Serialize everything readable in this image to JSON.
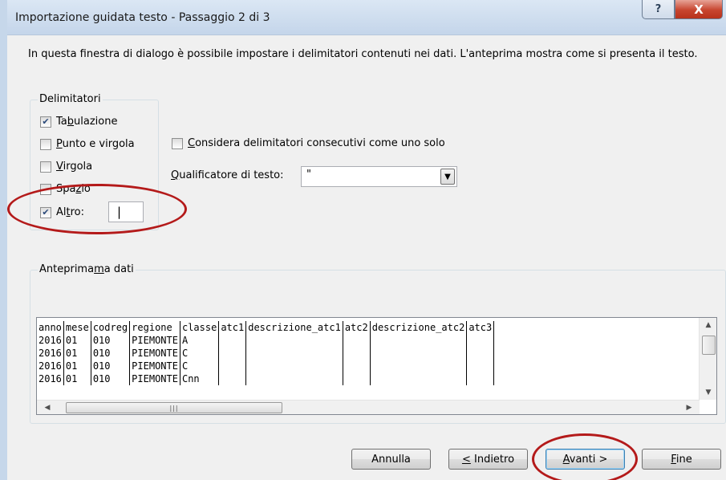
{
  "window": {
    "title": "Importazione guidata testo - Passaggio 2 di 3",
    "help_symbol": "?",
    "close_symbol": "X"
  },
  "intro_text": "In questa finestra di dialogo è possibile impostare i delimitatori contenuti nei dati. L'anteprima mostra come si presenta il testo.",
  "delimiters": {
    "legend": "Delimitatori",
    "tab": {
      "pre": "Ta",
      "key": "b",
      "post": "ulazione",
      "checked": true
    },
    "semicolon": {
      "pre": "",
      "key": "P",
      "post": "unto e virgola",
      "checked": false
    },
    "comma": {
      "pre": "",
      "key": "V",
      "post": "irgola",
      "checked": false
    },
    "space": {
      "pre": "Spa",
      "key": "z",
      "post": "io",
      "checked": false
    },
    "other": {
      "pre": "Al",
      "key": "t",
      "post": "ro:",
      "checked": true,
      "value": "|"
    }
  },
  "consecutive": {
    "pre": "",
    "key": "C",
    "post": "onsidera delimitatori consecutivi come uno solo",
    "checked": false
  },
  "qualifier": {
    "pre": "",
    "key": "Q",
    "post": "ualificatore di testo:",
    "value": "\""
  },
  "preview": {
    "legend_pre": "Anteprima",
    "legend_key": "m",
    "legend_post": "a dati",
    "rows": [
      [
        "anno",
        "mese",
        "codreg",
        "regione",
        "classe",
        "atc1",
        "descrizione_atc1",
        "atc2",
        "descrizione_atc2",
        "atc3"
      ],
      [
        "2016",
        "01",
        "010",
        "PIEMONTE",
        "A",
        "",
        "",
        "",
        "",
        ""
      ],
      [
        "2016",
        "01",
        "010",
        "PIEMONTE",
        "C",
        "",
        "",
        "",
        "",
        ""
      ],
      [
        "2016",
        "01",
        "010",
        "PIEMONTE",
        "C",
        "",
        "",
        "",
        "",
        ""
      ],
      [
        "2016",
        "01",
        "010",
        "PIEMONTE",
        "Cnn",
        "",
        "",
        "",
        "",
        ""
      ]
    ]
  },
  "buttons": {
    "cancel": "Annulla",
    "back_key": "<",
    "back_post": " Indietro",
    "next_key": "A",
    "next_post": "vanti >",
    "finish_key": "F",
    "finish_post": "ine"
  },
  "colors": {
    "annotation": "#b41a1a",
    "close_button": "#c7452f"
  }
}
